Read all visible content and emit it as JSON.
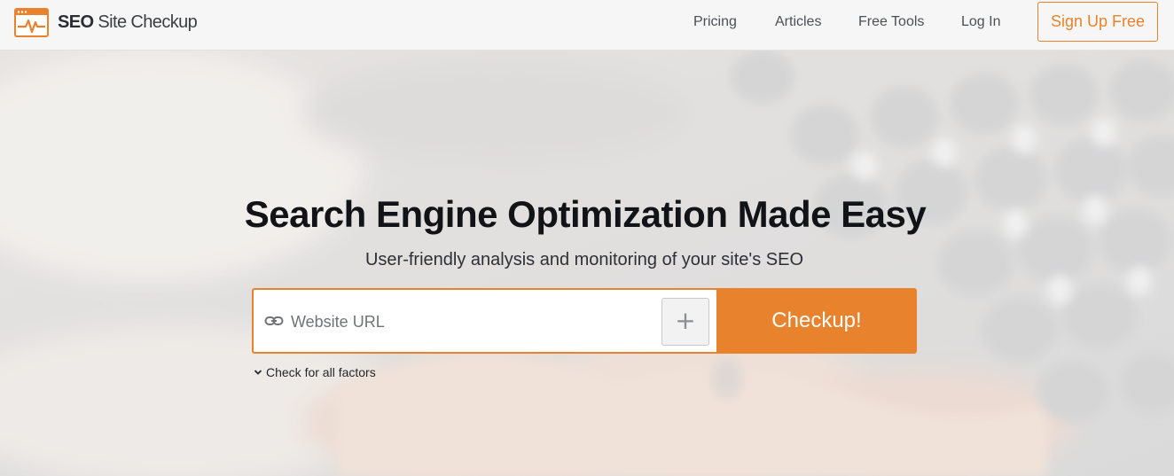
{
  "brand": {
    "name_bold": "SEO",
    "name_light": "Site Checkup",
    "accent_color": "#e8822d"
  },
  "nav": {
    "items": [
      {
        "label": "Pricing"
      },
      {
        "label": "Articles"
      },
      {
        "label": "Free Tools"
      },
      {
        "label": "Log In"
      }
    ],
    "signup_label": "Sign Up Free"
  },
  "hero": {
    "title": "Search Engine Optimization Made Easy",
    "subtitle": "User-friendly analysis and monitoring of your site's SEO",
    "search": {
      "placeholder": "Website URL",
      "value": "",
      "link_icon": "link-icon",
      "add_icon": "plus-icon",
      "add_label": "+"
    },
    "checkup_label": "Checkup!",
    "factors_label": "Check for all factors",
    "factors_icon": "chevron-down-icon"
  }
}
